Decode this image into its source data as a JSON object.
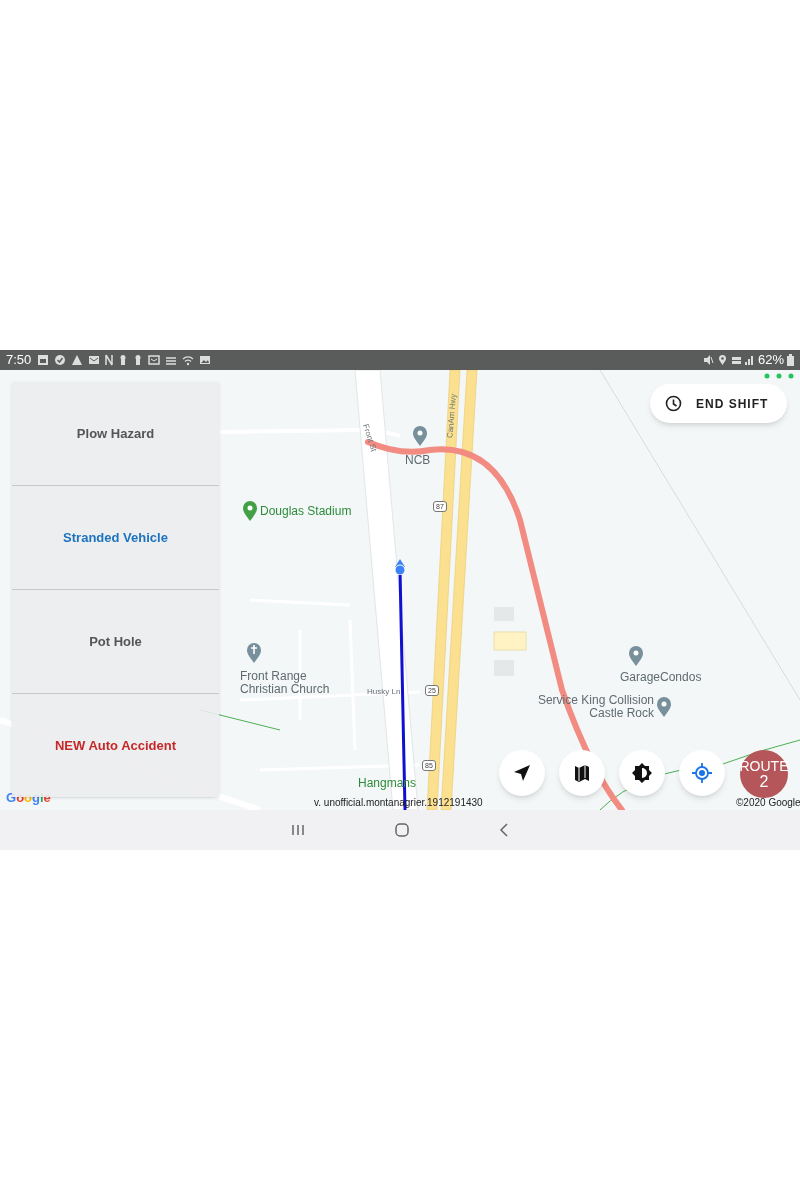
{
  "status_bar": {
    "time": "7:50",
    "battery": "62%"
  },
  "hazard_buttons": [
    {
      "label": "Plow Hazard",
      "color": "#555555"
    },
    {
      "label": "Stranded Vehicle",
      "color": "#1e73be"
    },
    {
      "label": "Pot Hole",
      "color": "#555555"
    },
    {
      "label": "NEW Auto Accident",
      "color": "#c62828"
    }
  ],
  "end_shift_button": {
    "label": "END SHIFT"
  },
  "map": {
    "labels": [
      {
        "text": "NCB",
        "kind": "poi"
      },
      {
        "text": "Douglas Stadium",
        "kind": "park"
      },
      {
        "text": "Front Range Christian Church",
        "kind": "poi"
      },
      {
        "text": "GarageCondos",
        "kind": "poi"
      },
      {
        "text": "Service King Collision Castle Rock",
        "kind": "poi"
      },
      {
        "text": "Hangmans",
        "kind": "park"
      },
      {
        "text": "Front St",
        "kind": "road"
      },
      {
        "text": "CanAm Hwy",
        "kind": "road"
      },
      {
        "text": "Husky Ln",
        "kind": "road"
      },
      {
        "text": "87",
        "kind": "shield"
      },
      {
        "text": "25",
        "kind": "shield"
      },
      {
        "text": "85",
        "kind": "shield"
      }
    ],
    "logo": "Google",
    "version": "v. unofficial.montanagrier.1912191430",
    "copyright": "©2020 Google"
  },
  "map_buttons": [
    {
      "kind": "navigate"
    },
    {
      "kind": "map"
    },
    {
      "kind": "brightness"
    },
    {
      "kind": "locate"
    }
  ],
  "route_button": {
    "label": "ROUTE",
    "number": "2"
  }
}
